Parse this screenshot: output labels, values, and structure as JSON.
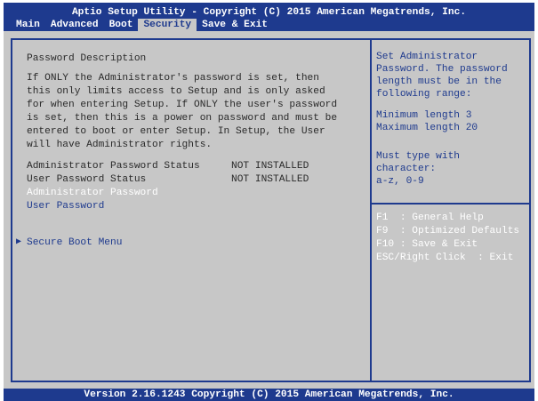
{
  "header": {
    "title": "Aptio Setup Utility - Copyright (C) 2015 American Megatrends, Inc.",
    "tabs": [
      "Main",
      "Advanced",
      "Boot",
      "Security",
      "Save & Exit"
    ],
    "active_tab": "Security"
  },
  "left_panel": {
    "heading": "Password Description",
    "description": [
      "If ONLY the Administrator's password is set, then",
      "this only limits access to Setup and is only asked",
      "for when entering Setup. If ONLY the user's password",
      "is set, then this is a power on password and must be",
      "entered to boot or enter Setup. In Setup, the User",
      "will have Administrator rights."
    ],
    "status_rows": [
      {
        "label": "Administrator Password Status",
        "value": "NOT INSTALLED"
      },
      {
        "label": "User Password Status",
        "value": "NOT INSTALLED"
      }
    ],
    "menu_items": [
      "Administrator Password",
      "User Password"
    ],
    "submenu": "Secure Boot Menu"
  },
  "help_panel": {
    "lines": [
      "Set Administrator",
      "Password. The password",
      "length must be in the",
      "following range:",
      "Minimum length 3",
      "Maximum length 20",
      "Must type with",
      "character:",
      "a-z, 0-9"
    ],
    "keys": [
      "F1  : General Help",
      "F9  : Optimized Defaults",
      "F10 : Save & Exit",
      "ESC/Right Click  : Exit"
    ]
  },
  "footer": {
    "version": "Version 2.16.1243 Copyright (C) 2015 American Megatrends, Inc."
  },
  "colors": {
    "bar_blue": "#1e3a8e",
    "panel_grey": "#c7c7c7",
    "highlight_white": "#ffffff"
  }
}
